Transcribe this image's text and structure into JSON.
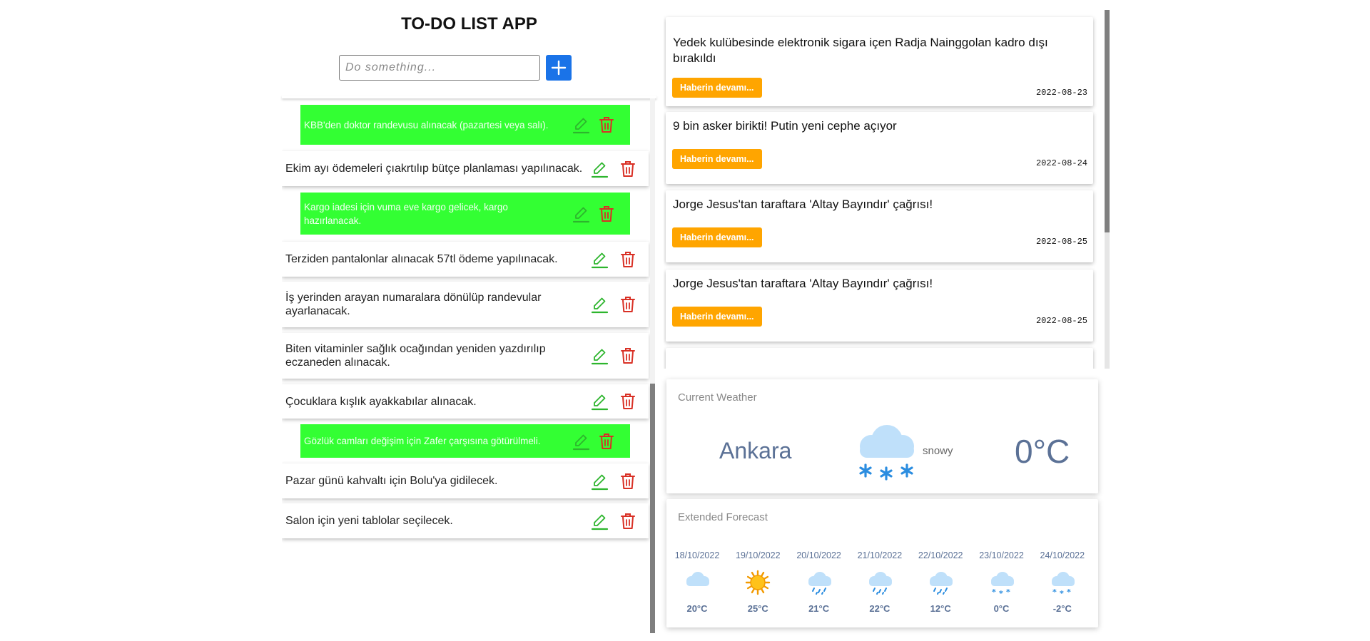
{
  "todo": {
    "title": "TO-DO LIST APP",
    "input_placeholder": "Do something...",
    "items": [
      {
        "text": "KBB'den doktor randevusu alınacak (pazartesi veya salı).",
        "done": true
      },
      {
        "text": "Ekim ayı ödemeleri çıakrtılıp bütçe planlaması yapılınacak.",
        "done": false
      },
      {
        "text": "Kargo iadesi için vuma eve kargo gelicek, kargo hazırlanacak.",
        "done": true
      },
      {
        "text": "Terziden pantalonlar alınacak 57tl ödeme yapılınacak.",
        "done": false
      },
      {
        "text": "İş yerinden arayan numaralara dönülüp randevular ayarlanacak.",
        "done": false
      },
      {
        "text": "Biten vitaminler sağlık ocağından yeniden yazdırılıp eczaneden alınacak.",
        "done": false
      },
      {
        "text": "Çocuklara kışlık ayakkabılar alınacak.",
        "done": false
      },
      {
        "text": "Gözlük camları değişim için Zafer çarşısına götürülmeli.",
        "done": true
      },
      {
        "text": "Pazar günü kahvaltı için Bolu'ya gidilecek.",
        "done": false
      },
      {
        "text": "Salon için yeni tablolar seçilecek.",
        "done": false
      }
    ]
  },
  "news": {
    "button_label": "Haberin devamı...",
    "items": [
      {
        "title": "Yedek kulübesinde elektronik sigara içen Radja Nainggolan kadro dışı bırakıldı",
        "date": "2022-08-23"
      },
      {
        "title": "9 bin asker birikti! Putin yeni cephe açıyor",
        "date": "2022-08-24"
      },
      {
        "title": "Jorge Jesus'tan taraftara 'Altay Bayındır' çağrısı!",
        "date": "2022-08-25"
      },
      {
        "title": "Jorge Jesus'tan taraftara 'Altay Bayındır' çağrısı!",
        "date": "2022-08-25"
      }
    ]
  },
  "weather": {
    "current_label": "Current Weather",
    "city": "Ankara",
    "condition": "snowy",
    "temperature": "0°C",
    "icon": "snow-cloud-icon"
  },
  "forecast": {
    "label": "Extended Forecast",
    "days": [
      {
        "date": "18/10/2022",
        "temp": "20°C",
        "icon": "cloud"
      },
      {
        "date": "19/10/2022",
        "temp": "25°C",
        "icon": "sun"
      },
      {
        "date": "20/10/2022",
        "temp": "21°C",
        "icon": "rain"
      },
      {
        "date": "21/10/2022",
        "temp": "22°C",
        "icon": "rain"
      },
      {
        "date": "22/10/2022",
        "temp": "12°C",
        "icon": "rain"
      },
      {
        "date": "23/10/2022",
        "temp": "0°C",
        "icon": "snow"
      },
      {
        "date": "24/10/2022",
        "temp": "-2°C",
        "icon": "snow"
      }
    ]
  },
  "colors": {
    "done_bg": "#33ff33",
    "edit": "#2db52d",
    "delete": "#d93025",
    "add_button": "#1a73e8",
    "news_button": "#ffa500",
    "weather_text": "#5b7196"
  }
}
